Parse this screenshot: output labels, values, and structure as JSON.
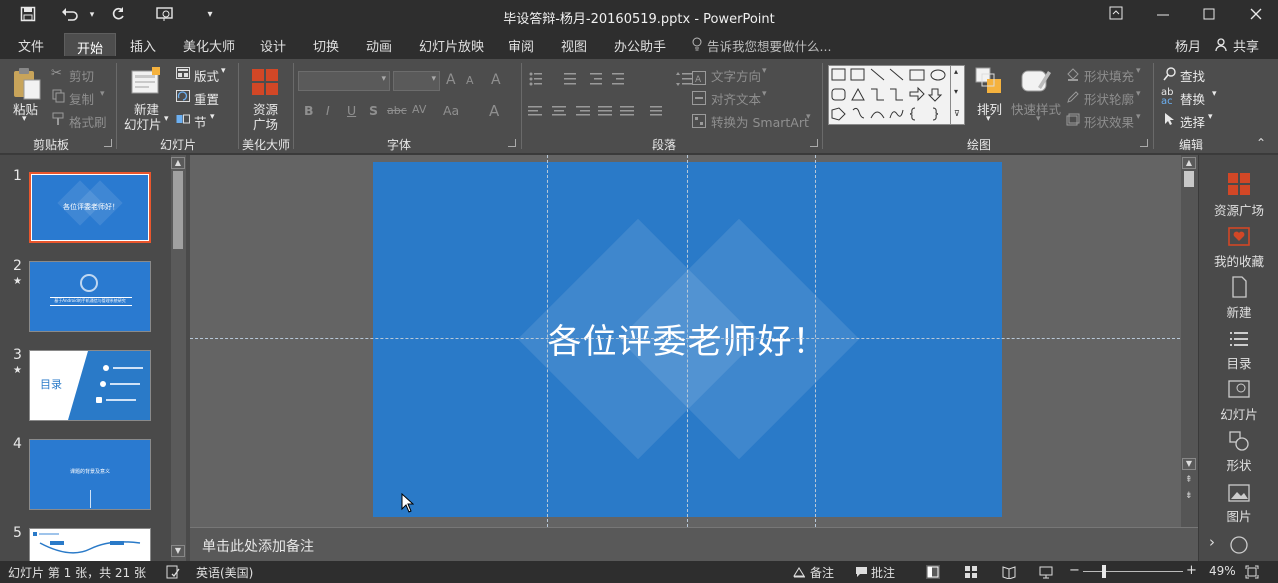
{
  "window": {
    "title": "毕设答辩-杨月-20160519.pptx - PowerPoint"
  },
  "ribbon_tabs": [
    "文件",
    "开始",
    "插入",
    "美化大师",
    "设计",
    "切换",
    "动画",
    "幻灯片放映",
    "审阅",
    "视图",
    "办公助手"
  ],
  "tell_me": "告诉我您想要做什么...",
  "user": "杨月",
  "share": "共享",
  "clipboard": {
    "paste": "粘贴",
    "cut": "剪切",
    "copy": "复制",
    "format_painter": "格式刷",
    "group": "剪贴板"
  },
  "slides_group": {
    "new_slide_1": "新建",
    "new_slide_2": "幻灯片",
    "layout": "版式",
    "reset": "重置",
    "section": "节",
    "group": "幻灯片"
  },
  "meihua": {
    "label_1": "资源",
    "label_2": "广场",
    "group": "美化大师"
  },
  "font": {
    "group": "字体",
    "bold": "B",
    "italic": "I",
    "underline": "U",
    "shadow": "S",
    "strike": "abc",
    "spacing": "AV",
    "case": "Aa",
    "grow": "A",
    "shrink": "A",
    "clear": "A"
  },
  "paragraph": {
    "group": "段落",
    "text_direction": "文字方向",
    "align_text": "对齐文本",
    "smartart": "转换为 SmartArt"
  },
  "drawing": {
    "group": "绘图",
    "arrange": "排列",
    "quick_styles": "快速样式",
    "shape_fill": "形状填充",
    "shape_outline": "形状轮廓",
    "shape_effects": "形状效果"
  },
  "editing": {
    "group": "编辑",
    "find": "查找",
    "replace": "替换",
    "select": "选择"
  },
  "thumbnails": [
    {
      "num": "1",
      "star": "",
      "text": "各位评委老师好！"
    },
    {
      "num": "2",
      "star": "★",
      "text": "基于Android的手机通信与管理系统研究"
    },
    {
      "num": "3",
      "star": "★",
      "text": "目录"
    },
    {
      "num": "4",
      "star": "",
      "text": "课题的背景及意义"
    },
    {
      "num": "5",
      "star": "",
      "text": ""
    }
  ],
  "slide": {
    "title": "各位评委老师好！"
  },
  "notes": {
    "placeholder": "单击此处添加备注"
  },
  "right_pane": [
    "资源广场",
    "我的收藏",
    "新建",
    "目录",
    "幻灯片",
    "形状",
    "图片"
  ],
  "status": {
    "slide_info": "幻灯片 第 1 张，共 21 张",
    "language": "英语(美国)",
    "notes": "备注",
    "comments": "批注",
    "zoom": "49%"
  },
  "colors": {
    "slide_bg": "#2a7ac8",
    "accent_orange": "#d24726",
    "chrome_dark": "#2e2e2e"
  }
}
